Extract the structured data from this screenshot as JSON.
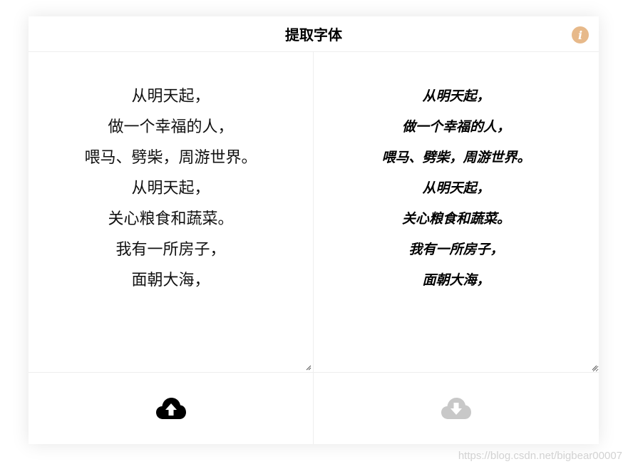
{
  "header": {
    "title": "提取字体",
    "info_icon": "info-icon",
    "info_color": "#e7b98a"
  },
  "input_text": {
    "lines": [
      "从明天起，",
      "做一个幸福的人，",
      "喂马、劈柴，周游世界。",
      "从明天起，",
      "关心粮食和蔬菜。",
      "我有一所房子，",
      "面朝大海，"
    ]
  },
  "output_text": {
    "lines": [
      "从明天起，",
      "做一个幸福的人，",
      "喂马、劈柴，周游世界。",
      "从明天起，",
      "关心粮食和蔬菜。",
      "我有一所房子，",
      "面朝大海，"
    ]
  },
  "footer": {
    "upload_icon": "cloud-upload-icon",
    "upload_color": "#000000",
    "download_icon": "cloud-download-icon",
    "download_color": "#c8c8c8"
  },
  "watermark": "https://blog.csdn.net/bigbear00007"
}
